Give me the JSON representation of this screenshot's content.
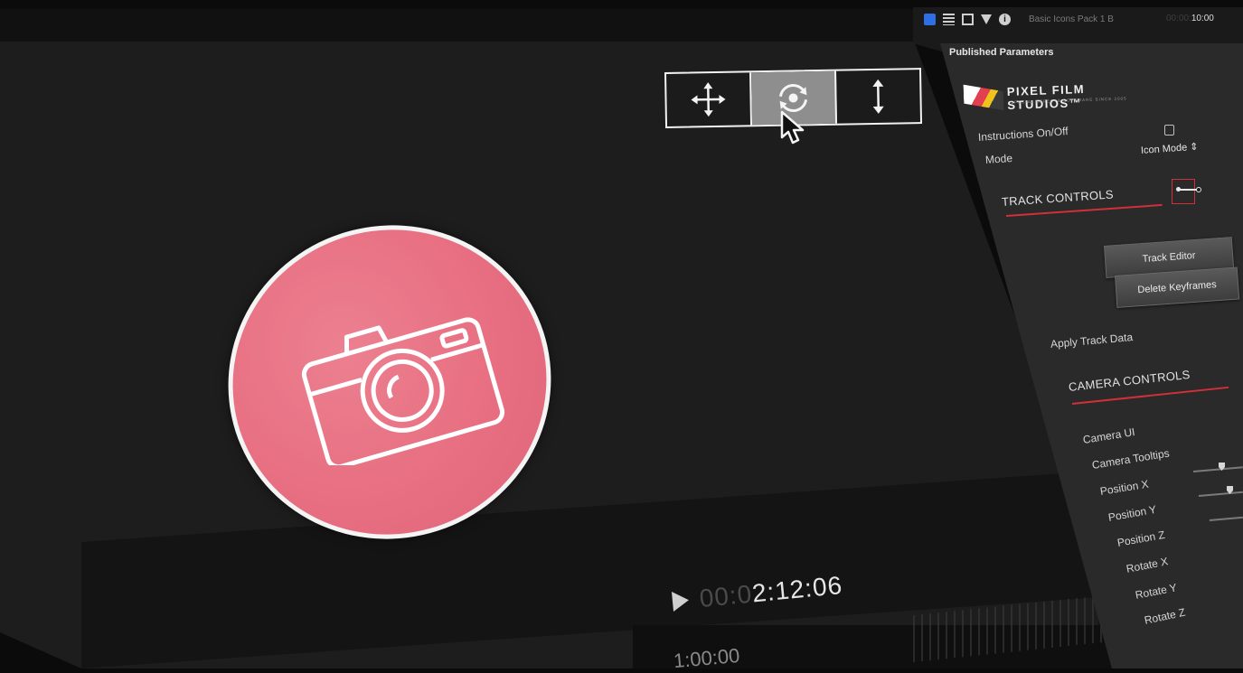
{
  "app": {
    "inspector": {
      "clip_name": "Basic Icons Pack 1 B",
      "clip_time_dim": "00:00:",
      "clip_time": "10:00",
      "tabs": [
        "video-inspector-tab",
        "text-inspector-tab",
        "film-inspector-tab",
        "filter-inspector-tab",
        "info-inspector-tab"
      ],
      "info_glyph": "i"
    },
    "viewer": {
      "toolbar": [
        "move-icon",
        "rotate-icon",
        "vertical-resize-icon"
      ],
      "active_tool_index": 1,
      "timecode_dim": "00:0",
      "timecode": "2:12:06",
      "timecode_lower": "1:00:00",
      "icon": "camera-icon",
      "disc_color": "#e76f81"
    },
    "panel": {
      "title": "Published Parameters",
      "logo_name": "PIXEL FILM STUDIOS",
      "logo_tm": "™",
      "logo_tagline": "SPECIAL EFFECTS SOFTWARE SINCE 2005",
      "instructions_label": "Instructions On/Off",
      "instructions_checked": false,
      "mode_label": "Mode",
      "mode_value": "Icon Mode",
      "mode_arrows": "⇕",
      "track_controls": "TRACK CONTROLS",
      "track_editor_button": "Track Editor",
      "delete_keyframes_button": "Delete Keyframes",
      "apply_track_data": "Apply Track Data",
      "camera_controls": "CAMERA CONTROLS",
      "camera_params": [
        "Camera UI",
        "Camera Tooltips",
        "Position X",
        "Position Y",
        "Position Z",
        "Rotate X",
        "Rotate Y",
        "Rotate Z"
      ],
      "accent": "#d0303a"
    }
  }
}
